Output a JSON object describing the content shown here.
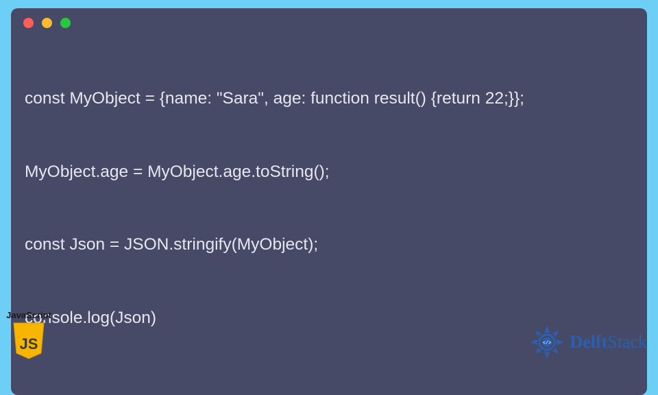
{
  "code_window": {
    "lines": [
      "const MyObject = {name: \"Sara\", age: function result() {return 22;}};",
      "MyObject.age = MyObject.age.toString();",
      "const Json = JSON.stringify(MyObject);",
      "console.log(Json)"
    ],
    "traffic_lights": [
      "red",
      "yellow",
      "green"
    ]
  },
  "js_badge": {
    "label": "JavaScript",
    "icon_text": "JS"
  },
  "brand": {
    "name_part1": "Delft",
    "name_part2": "Stack"
  },
  "colors": {
    "page_bg": "#6dcff6",
    "window_bg": "#474a67",
    "code_fg": "#e6e6ee",
    "brand_blue": "#2b5fb0",
    "js_yellow": "#f7b500"
  }
}
